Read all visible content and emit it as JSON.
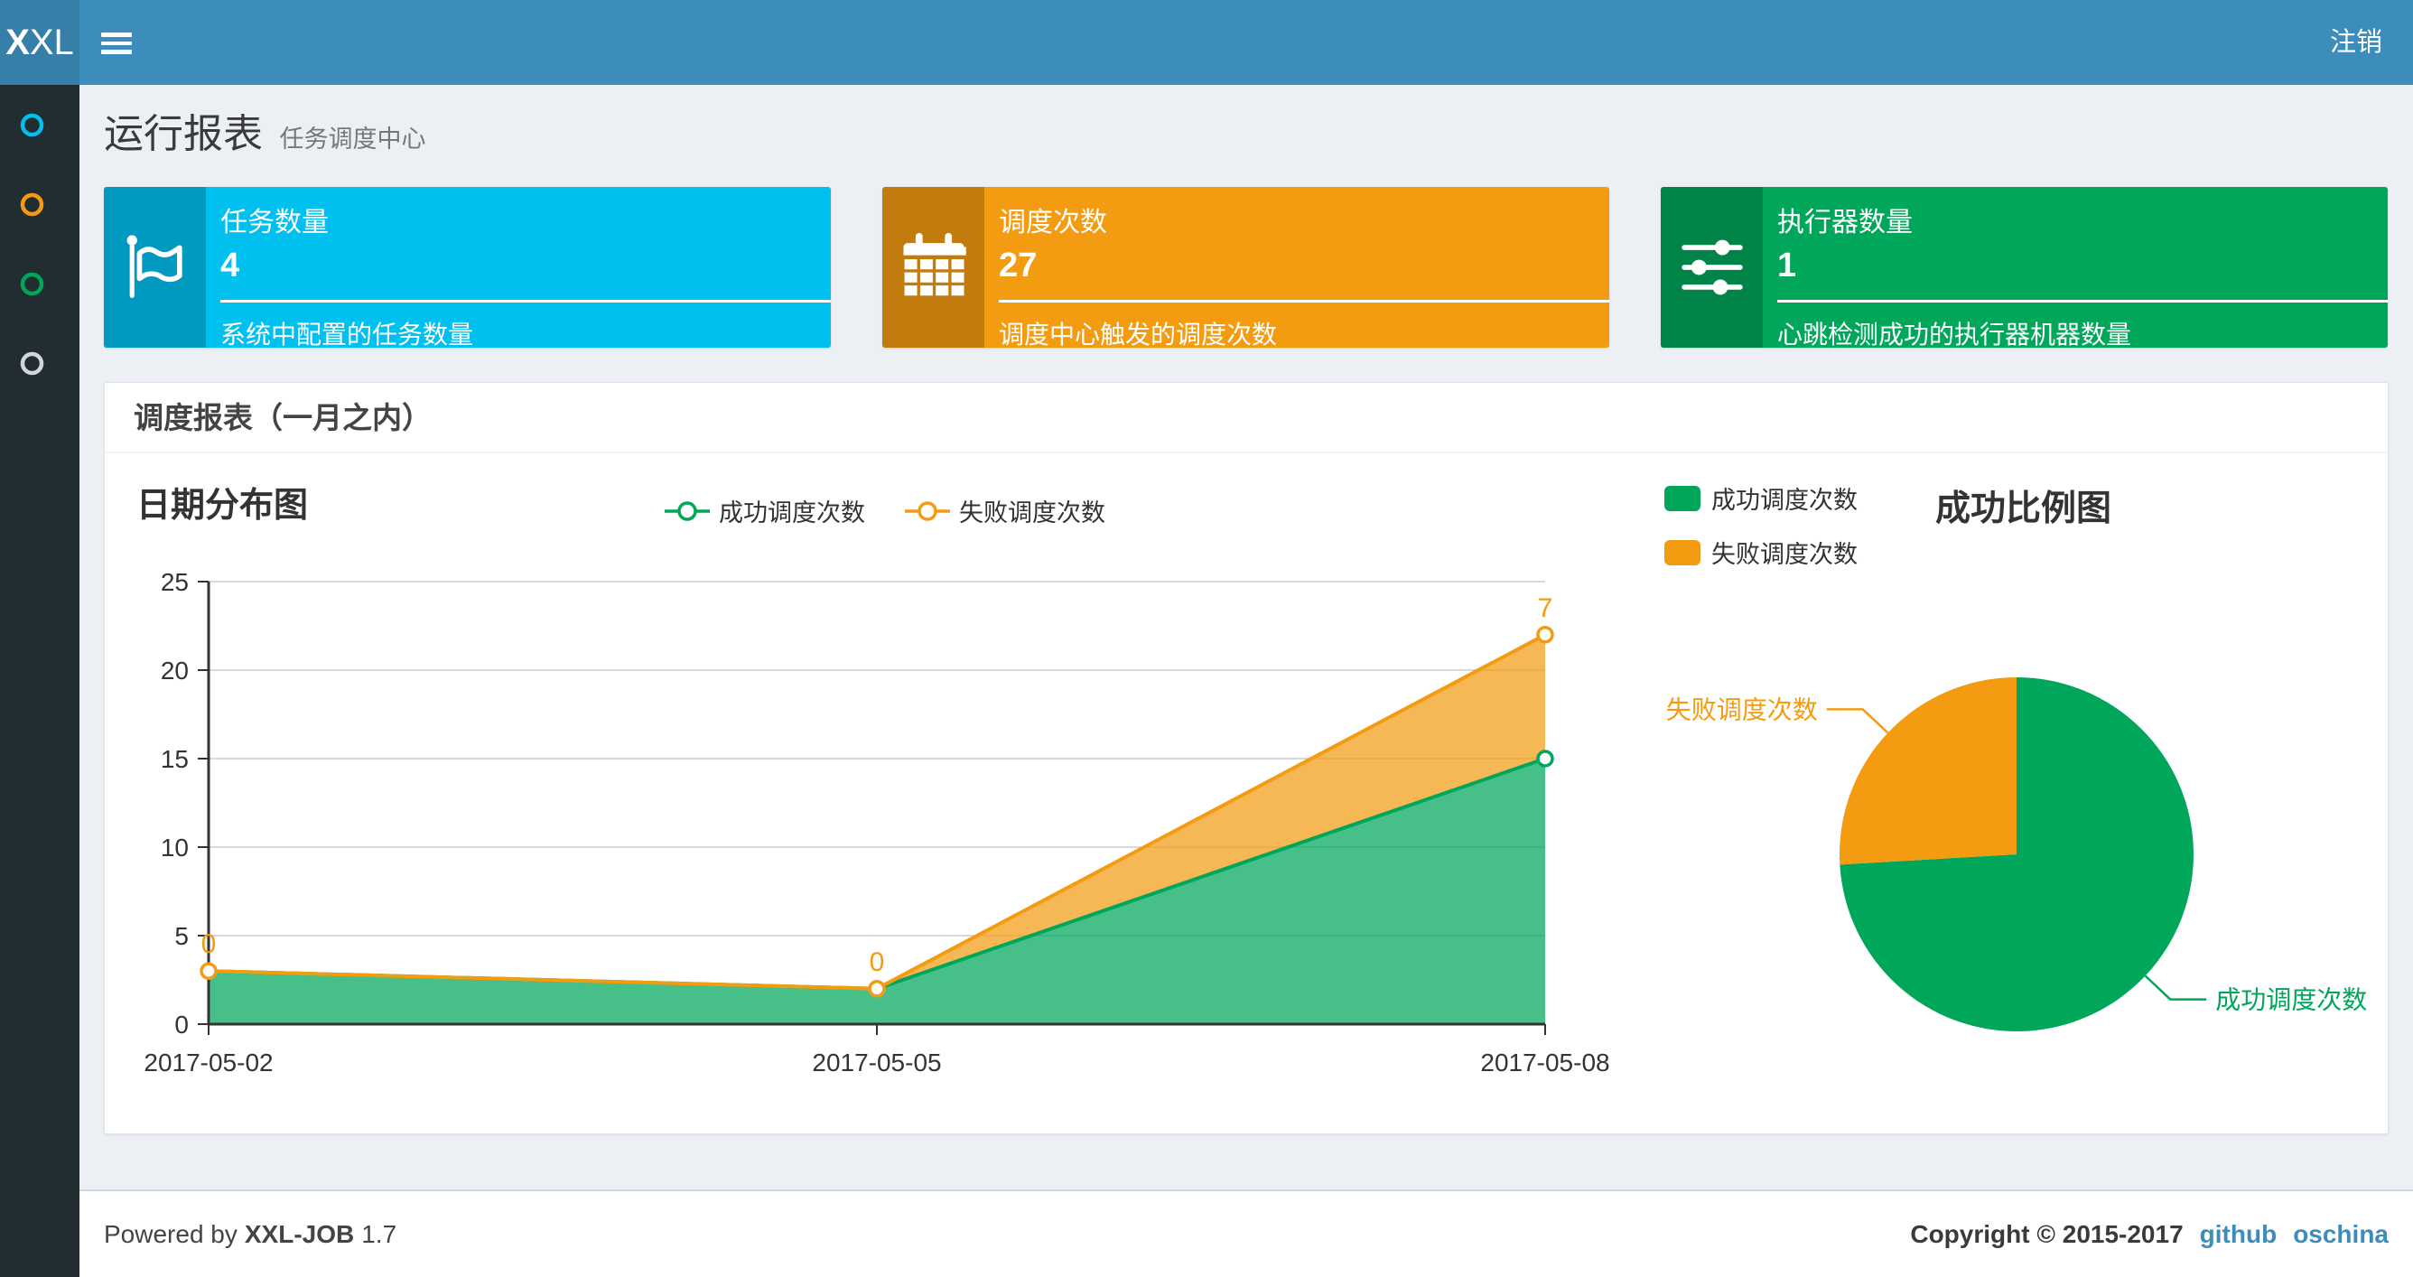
{
  "navbar": {
    "logo_bold": "X",
    "logo_rest": "XL",
    "logout_label": "注销"
  },
  "sidebar": {
    "items": [
      {
        "name": "menu-circle-1",
        "color": "#00C0EF"
      },
      {
        "name": "menu-circle-2",
        "color": "#F39C12"
      },
      {
        "name": "menu-circle-3",
        "color": "#00A65A"
      },
      {
        "name": "menu-circle-4",
        "color": "#D2D6DE"
      }
    ]
  },
  "page_header": {
    "title": "运行报表",
    "subtitle": "任务调度中心"
  },
  "info_boxes": [
    {
      "icon": "flag-icon",
      "title": "任务数量",
      "value": "4",
      "description": "系统中配置的任务数量",
      "color": "#00C0EF"
    },
    {
      "icon": "calendar-icon",
      "title": "调度次数",
      "value": "27",
      "description": "调度中心触发的调度次数",
      "color": "#F39C12"
    },
    {
      "icon": "sliders-icon",
      "title": "执行器数量",
      "value": "1",
      "description": "心跳检测成功的执行器机器数量",
      "color": "#00A65A"
    }
  ],
  "panel": {
    "title": "调度报表（一月之内）"
  },
  "chart_data": [
    {
      "type": "area",
      "title": "日期分布图",
      "x": [
        "2017-05-02",
        "2017-05-05",
        "2017-05-08"
      ],
      "series": [
        {
          "name": "成功调度次数",
          "color": "#00A65A",
          "values": [
            3,
            2,
            15
          ]
        },
        {
          "name": "失败调度次数",
          "color": "#F39C12",
          "values": [
            0,
            0,
            7
          ]
        }
      ],
      "stacked": true,
      "point_labels_series": "失败调度次数",
      "point_labels": [
        0,
        0,
        7
      ],
      "ylim": [
        0,
        25
      ],
      "yticks": [
        0,
        5,
        10,
        15,
        20,
        25
      ],
      "grid": true,
      "legend_position": "top-center"
    },
    {
      "type": "pie",
      "title": "成功比例图",
      "slices": [
        {
          "label": "成功调度次数",
          "value": 20,
          "color": "#00A65A"
        },
        {
          "label": "失败调度次数",
          "value": 7,
          "color": "#F39C12"
        }
      ],
      "legend_position": "top-left"
    }
  ],
  "footer": {
    "powered_prefix": "Powered by",
    "product": "XXL-JOB",
    "version": "1.7",
    "copyright": "Copyright © 2015-2017",
    "links": [
      "github",
      "oschina"
    ]
  },
  "colors": {
    "navbar": "#3C8DBC",
    "logo_bg": "#367FA9",
    "sidebar_bg": "#222D32",
    "content_bg": "#ECF0F5",
    "success": "#00A65A",
    "warning": "#F39C12",
    "info": "#00C0EF",
    "link": "#3C8DBC",
    "axis": "#333333",
    "gridline": "#CCCCCC"
  }
}
